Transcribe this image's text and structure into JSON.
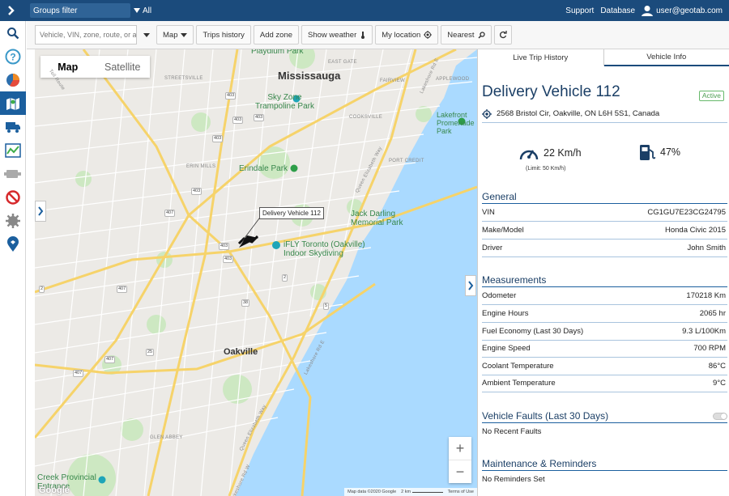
{
  "topbar": {
    "groups_filter": "Groups filter",
    "all_label": "All",
    "support": "Support",
    "database": "Database",
    "user": "user@geotab.com"
  },
  "toolbar": {
    "search_placeholder": "Vehicle, VIN, zone, route, or a",
    "map": "Map",
    "trips_history": "Trips history",
    "add_zone": "Add zone",
    "show_weather": "Show weather",
    "my_location": "My location",
    "nearest": "Nearest"
  },
  "map": {
    "type_map": "Map",
    "type_satellite": "Satellite",
    "cities": [
      "Mississauga",
      "Oakville"
    ],
    "parks": [
      {
        "name": "Playdium Park"
      },
      {
        "name": "Sky Zone\nTrampoline Park"
      },
      {
        "name": "Erindale Park"
      },
      {
        "name": "Lakefront\nPromenade\nPark"
      },
      {
        "name": "Jack Darling\nMemorial Park"
      },
      {
        "name": "iFLY Toronto (Oakville)\nIndoor Skydiving"
      },
      {
        "name": "Creek Provincial\nEntrance"
      }
    ],
    "streets": [
      "STREETSVILLE",
      "EAST GATE",
      "FAIRVIEW",
      "APPLEWOOD",
      "COOKSVILLE",
      "ERIN MILLS",
      "PORT CREDIT",
      "GLEN ABBEY",
      "Queen Elizabeth Way",
      "Lakeshore Rd E",
      "Queen Elizabeth Way",
      "Lakeshore Rd E",
      "Lakeshore Rd W",
      "Toll Route"
    ],
    "shields": [
      "403",
      "403",
      "403",
      "403",
      "407",
      "407",
      "407",
      "407",
      "403",
      "403",
      "403",
      "38",
      "5",
      "25",
      "2",
      "2"
    ],
    "vehicle_callout": "Delivery Vehicle 112",
    "zoom_in": "+",
    "zoom_out": "−",
    "attribution": [
      "Map data ©2020 Google",
      "2 km",
      "Terms of Use"
    ],
    "google": "Google"
  },
  "panel": {
    "tabs": [
      "Live Trip History",
      "Vehicle Info"
    ],
    "title": "Delivery Vehicle 112",
    "status": "Active",
    "address": "2568 Bristol Cir, Oakville, ON L6H 5S1, Canada",
    "speed": "22 Km/h",
    "speed_limit": "(Limit: 50 Km/h)",
    "fuel": "47%",
    "sections": {
      "general": "General",
      "measurements": "Measurements",
      "faults": "Vehicle Faults (Last 30 Days)",
      "maintenance": "Maintenance & Reminders"
    },
    "general": [
      {
        "label": "VIN",
        "value": "CG1GU7E23CG24795"
      },
      {
        "label": "Make/Model",
        "value": "Honda Civic 2015"
      },
      {
        "label": "Driver",
        "value": "John Smith"
      }
    ],
    "measurements": [
      {
        "label": "Odometer",
        "value": "170218 Km"
      },
      {
        "label": "Engine Hours",
        "value": "2065 hr"
      },
      {
        "label": "Fuel Economy (Last 30 Days)",
        "value": "9.3 L/100Km"
      },
      {
        "label": "Engine Speed",
        "value": "700 RPM"
      },
      {
        "label": "Coolant Temperature",
        "value": "86°C"
      },
      {
        "label": "Ambient Temperature",
        "value": "9°C"
      }
    ],
    "no_faults": "No Recent Faults",
    "no_reminders": "No Reminders Set"
  },
  "colors": {
    "brand": "#1b4b7c",
    "water": "#aadaff",
    "park": "#cce8c0",
    "highway": "#f6d66b"
  }
}
